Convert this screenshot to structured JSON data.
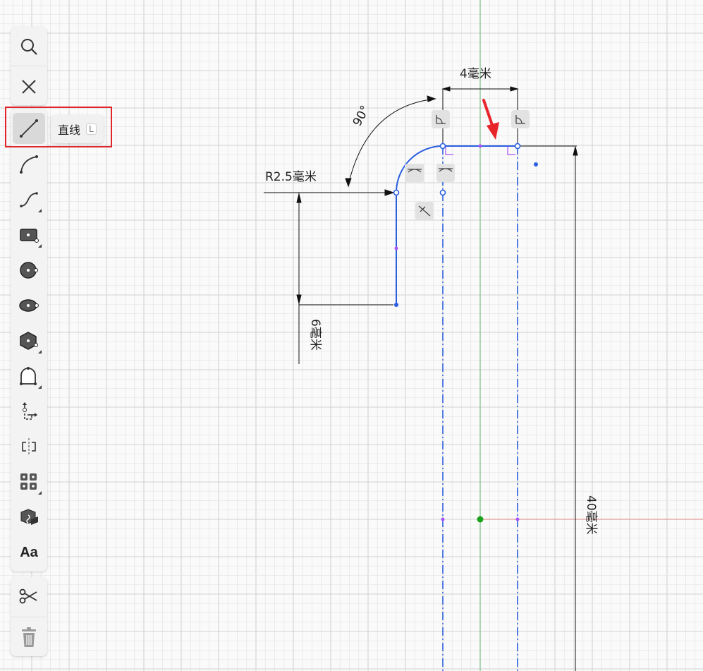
{
  "toolbar_top": [
    {
      "name": "search-icon",
      "interactable": true
    },
    {
      "name": "close-icon",
      "interactable": true
    }
  ],
  "toolbar_main": [
    {
      "name": "line-tool",
      "label": "直线",
      "shortcut": "L",
      "active": true
    },
    {
      "name": "arc-tool"
    },
    {
      "name": "spline-tool"
    },
    {
      "name": "rectangle-tool"
    },
    {
      "name": "circle-tool"
    },
    {
      "name": "ellipse-tool"
    },
    {
      "name": "polygon-tool"
    },
    {
      "name": "slot-tool"
    },
    {
      "name": "point-tool"
    },
    {
      "name": "mirror-tool"
    },
    {
      "name": "pattern-tool"
    },
    {
      "name": "project-tool"
    },
    {
      "name": "text-tool",
      "label": "Aa"
    }
  ],
  "toolbar_bottom": [
    {
      "name": "trim-tool"
    },
    {
      "name": "delete-tool"
    }
  ],
  "tooltip": {
    "label": "直线",
    "shortcut": "L"
  },
  "dimensions": {
    "top_width": "4毫米",
    "angle": "90°",
    "radius": "R2.5毫米",
    "left_height": "6毫米",
    "right_height": "40毫米"
  },
  "colors": {
    "sketch_blue": "#2b5fe0",
    "constraint_purple": "#a855f7",
    "axis_green": "#7cbf8a",
    "axis_red": "#e39a9a",
    "origin_green": "#1aa31a",
    "highlight_red": "#e0262b",
    "arrow_red": "#e8242b"
  }
}
